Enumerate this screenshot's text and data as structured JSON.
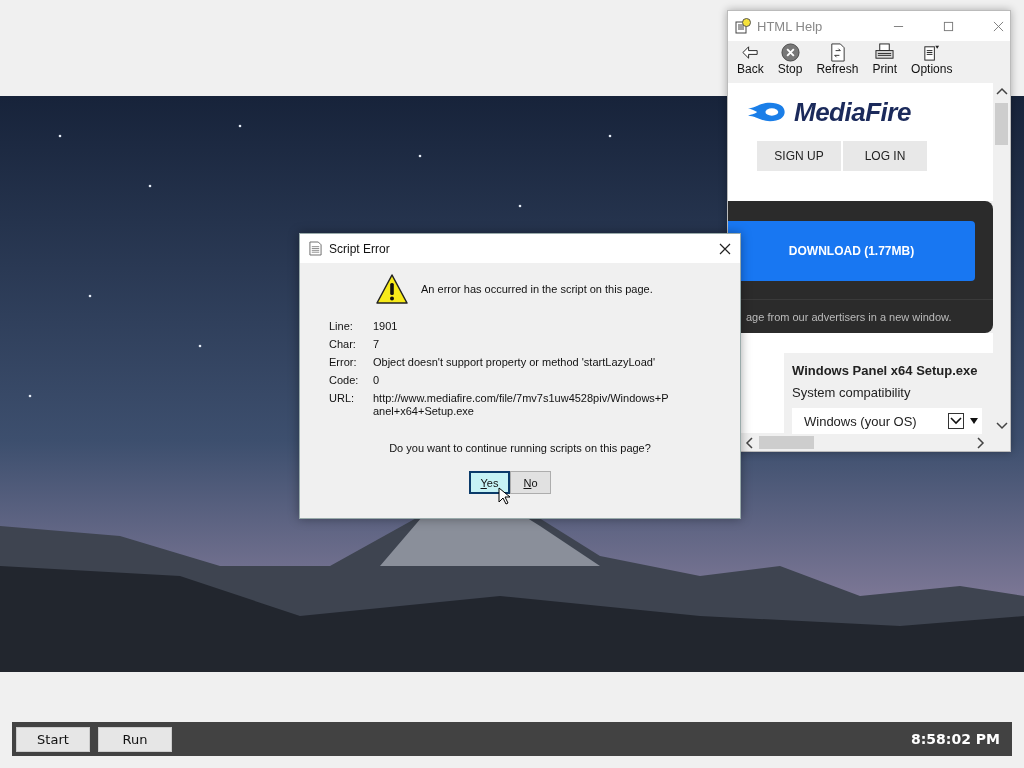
{
  "help_window": {
    "title": "HTML Help",
    "toolbar": [
      {
        "label": "Back",
        "kind": "back"
      },
      {
        "label": "Stop",
        "kind": "stop"
      },
      {
        "label": "Refresh",
        "kind": "refresh"
      },
      {
        "label": "Print",
        "kind": "print"
      },
      {
        "label": "Options",
        "kind": "options"
      }
    ],
    "page": {
      "logo": "MediaFire",
      "auth_buttons": [
        "SIGN UP",
        "LOG IN"
      ],
      "download_button": "DOWNLOAD (1.77MB)",
      "notice": "age from our advertisers in a new window.",
      "file_name": "Windows Panel x64 Setup.exe",
      "compatibility_label": "System compatibility",
      "os_select": {
        "value": "Windows (your OS)"
      }
    }
  },
  "dialog": {
    "title": "Script Error",
    "message": "An error has occurred in the script on this page.",
    "details": [
      {
        "label": "Line:",
        "value": "1901"
      },
      {
        "label": "Char:",
        "value": "7"
      },
      {
        "label": "Error:",
        "value": "Object doesn't support property or method 'startLazyLoad'"
      },
      {
        "label": "Code:",
        "value": "0"
      },
      {
        "label": "URL:",
        "value": "http://www.mediafire.com/file/7mv7s1uw4528piv/Windows+Panel+x64+Setup.exe"
      }
    ],
    "question": "Do you want to continue running scripts on this page?",
    "buttons": [
      {
        "label": "Yes",
        "focused": true
      },
      {
        "label": "No",
        "focused": false
      }
    ]
  },
  "taskbar": {
    "buttons": [
      "Start",
      "Run"
    ],
    "clock": "8:58:02 PM"
  }
}
